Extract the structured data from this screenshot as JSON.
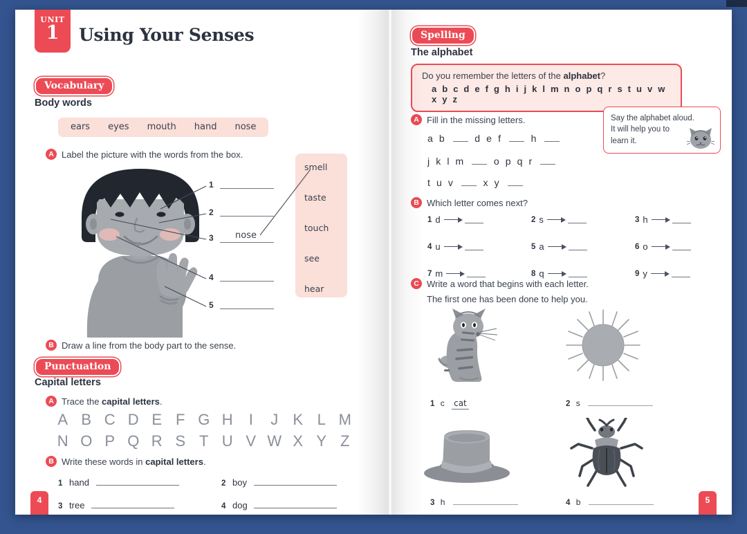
{
  "book": {
    "background_color": "#33548F",
    "accent_color": "#EC4B55",
    "soft_pink": "#FBDFD9"
  },
  "left_page": {
    "page_number": "4",
    "unit": {
      "label": "UNIT",
      "number": "1"
    },
    "title": "Using Your Senses",
    "vocabulary": {
      "pill": "Vocabulary",
      "subheading": "Body words",
      "word_box": [
        "ears",
        "eyes",
        "mouth",
        "hand",
        "nose"
      ],
      "task_a": {
        "marker": "A",
        "text": "Label the picture with the words from the box."
      },
      "callout_numbers": [
        "1",
        "2",
        "3",
        "4",
        "5"
      ],
      "filled_answer": "nose",
      "senses": [
        "smell",
        "taste",
        "touch",
        "see",
        "hear"
      ],
      "task_b": {
        "marker": "B",
        "text": "Draw a line from the body part to the sense."
      }
    },
    "punctuation": {
      "pill": "Punctuation",
      "subheading": "Capital letters",
      "task_a": {
        "marker": "A",
        "text_before": "Trace the ",
        "text_bold": "capital letters",
        "text_after": "."
      },
      "alphabet_row_1": [
        "A",
        "B",
        "C",
        "D",
        "E",
        "F",
        "G",
        "H",
        "I",
        "J",
        "K",
        "L",
        "M"
      ],
      "alphabet_row_2": [
        "N",
        "O",
        "P",
        "Q",
        "R",
        "S",
        "T",
        "U",
        "V",
        "W",
        "X",
        "Y",
        "Z"
      ],
      "task_b": {
        "marker": "B",
        "text_before": "Write these words in ",
        "text_bold": "capital letters",
        "text_after": "."
      },
      "words": [
        {
          "num": "1",
          "word": "hand"
        },
        {
          "num": "2",
          "word": "boy"
        },
        {
          "num": "3",
          "word": "tree"
        },
        {
          "num": "4",
          "word": "dog"
        }
      ]
    }
  },
  "right_page": {
    "page_number": "5",
    "spelling": {
      "pill": "Spelling",
      "subheading": "The alphabet",
      "callout": {
        "question_before": "Do you remember the letters of the ",
        "question_bold": "alphabet",
        "question_after": "?",
        "alphabet": "a b c d e f g h i j k l m n o p q r s t u v w x y z"
      },
      "task_a": {
        "marker": "A",
        "text": "Fill in the missing letters.",
        "rows": [
          {
            "tokens": [
              "a",
              "b",
              "_",
              "d",
              "e",
              "f",
              "_",
              "h",
              "_"
            ]
          },
          {
            "tokens": [
              "j",
              "k",
              "l",
              "m",
              "_",
              "o",
              "p",
              "q",
              "r",
              "_"
            ]
          },
          {
            "tokens": [
              "t",
              "u",
              "v",
              "_",
              "x",
              "y",
              "_"
            ]
          }
        ]
      },
      "tip_box": {
        "lines": [
          "Say the alphabet aloud.",
          "It will help you to",
          "learn it."
        ],
        "icon": "cat-head-icon"
      },
      "task_b": {
        "marker": "B",
        "text": "Which letter comes next?",
        "items": [
          {
            "num": "1",
            "letter": "d"
          },
          {
            "num": "2",
            "letter": "s"
          },
          {
            "num": "3",
            "letter": "h"
          },
          {
            "num": "4",
            "letter": "u"
          },
          {
            "num": "5",
            "letter": "a"
          },
          {
            "num": "6",
            "letter": "o"
          },
          {
            "num": "7",
            "letter": "m"
          },
          {
            "num": "8",
            "letter": "q"
          },
          {
            "num": "9",
            "letter": "y"
          }
        ]
      },
      "task_c": {
        "marker": "C",
        "text_line_1": "Write a word that begins with each letter.",
        "text_line_2": "The first one has been done to help you.",
        "items": [
          {
            "num": "1",
            "letter": "c",
            "answer": "cat",
            "picture": "cat-illustration"
          },
          {
            "num": "2",
            "letter": "s",
            "answer": "",
            "picture": "sun-illustration"
          },
          {
            "num": "3",
            "letter": "h",
            "answer": "",
            "picture": "hat-illustration"
          },
          {
            "num": "4",
            "letter": "b",
            "answer": "",
            "picture": "beetle-illustration"
          }
        ]
      }
    }
  }
}
